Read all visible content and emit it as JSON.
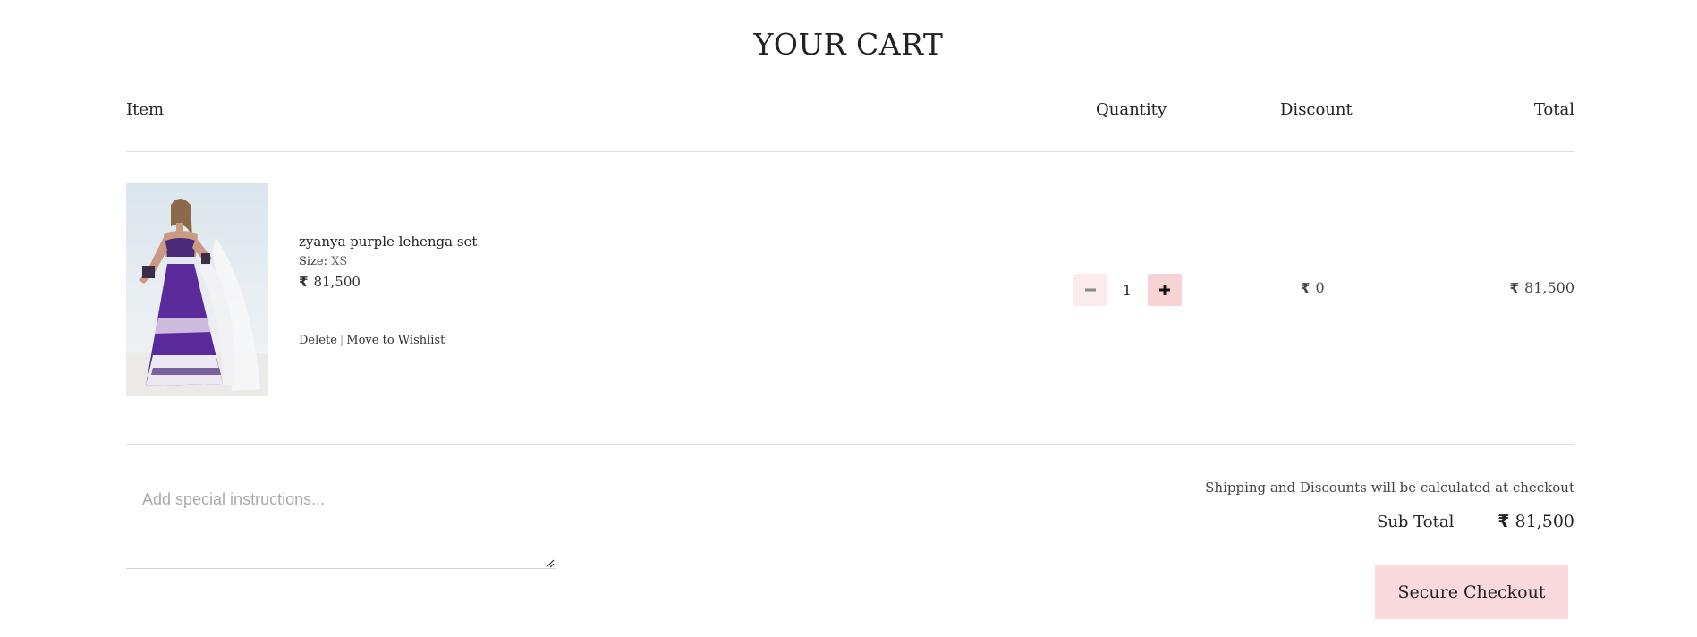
{
  "page": {
    "title": "YOUR CART"
  },
  "table_headers": {
    "item": "Item",
    "quantity": "Quantity",
    "discount": "Discount",
    "total": "Total"
  },
  "currency_symbol": "₹",
  "cart_items": [
    {
      "image_icon": "product-photo-purple-lehenga",
      "name": "zyanya purple lehenga set",
      "size_label": "Size:",
      "size": "XS",
      "price": "81,500",
      "quantity": "1",
      "discount": "0",
      "total": "81,500",
      "delete_label": "Delete",
      "separator": "|",
      "wishlist_label": "Move to Wishlist",
      "decrement_icon": "minus-icon",
      "increment_icon": "plus-icon"
    }
  ],
  "notes": {
    "placeholder": "Add special instructions..."
  },
  "summary": {
    "shipping_note": "Shipping and Discounts will be calculated at checkout",
    "subtotal_label": "Sub Total",
    "subtotal_value": "81,500",
    "checkout_label": "Secure Checkout"
  },
  "colors": {
    "accent_pink": "#fadadd",
    "plus_button": "#f8d3d6",
    "minus_button": "#fcebeb",
    "product_purple": "#5b2a9a"
  }
}
